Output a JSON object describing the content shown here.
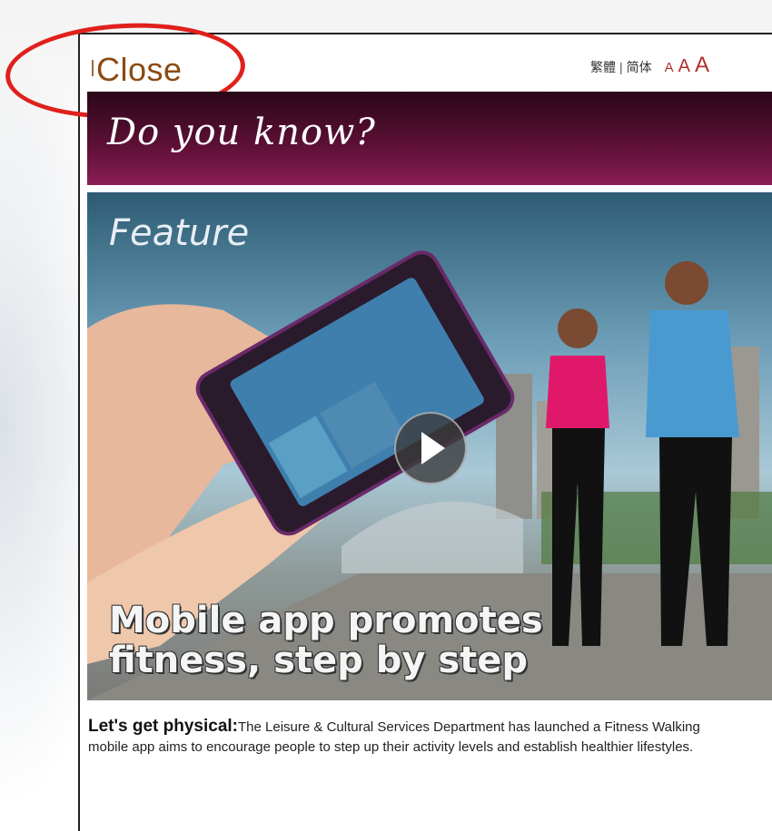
{
  "popup": {
    "close_label": "Close",
    "lang_traditional": "繁體",
    "lang_separator": "|",
    "lang_simplified": "简体",
    "font_small": "A",
    "font_medium": "A",
    "font_large": "A"
  },
  "banner": {
    "title": "Do you know?"
  },
  "feature": {
    "label": "Feature",
    "headline_line1": "Mobile app promotes",
    "headline_line2": "fitness, step by step"
  },
  "article": {
    "lead": "Let's get physical:",
    "body": "The Leisure & Cultural Services Department has launched a Fitness Walking mobile app aims to encourage people to step up their activity levels and establish healthier lifestyles."
  },
  "colors": {
    "banner": "#5b0f34",
    "close": "#8c4a12",
    "ring": "#e0201c"
  },
  "icons": {
    "play": "play-icon"
  }
}
